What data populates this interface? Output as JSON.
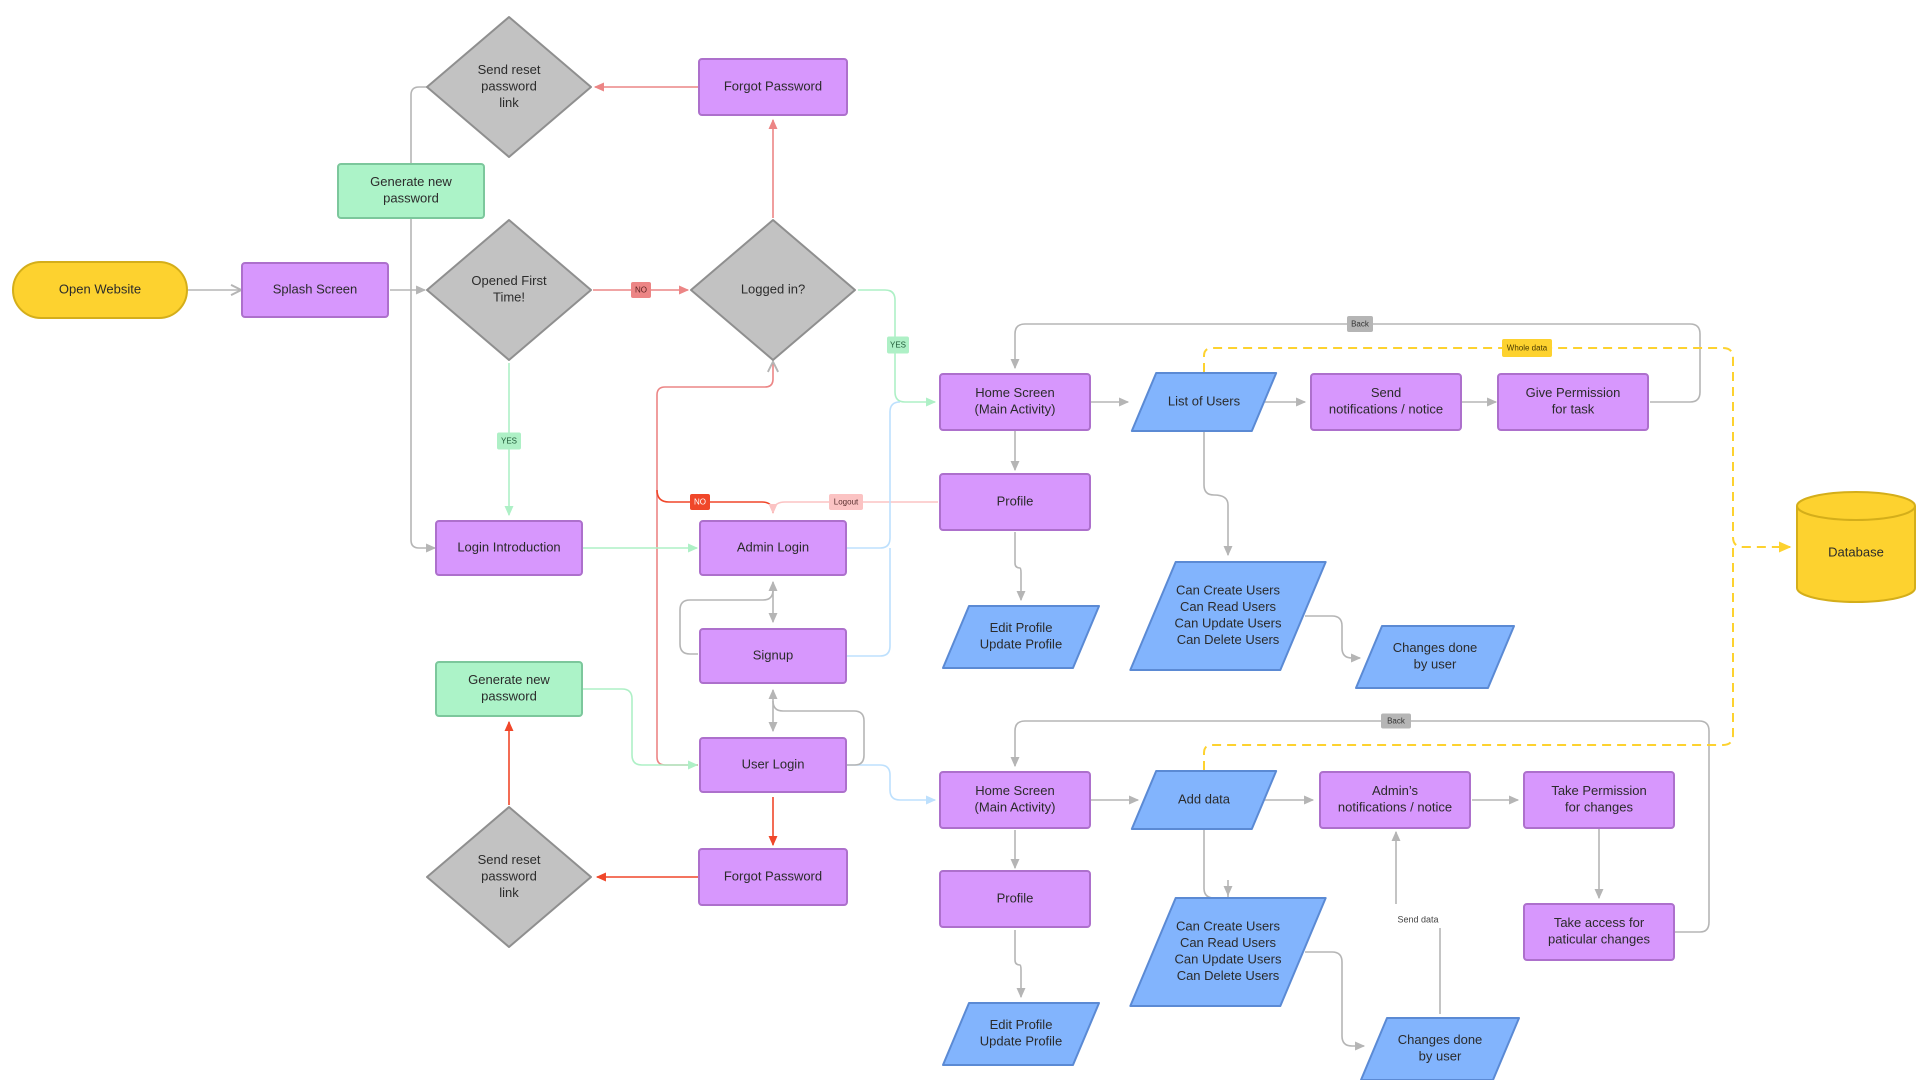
{
  "diagram": {
    "colors": {
      "terminal_fill": "#fdd22f",
      "terminal_stroke": "#d4ae1a",
      "process_fill": "#d797fd",
      "process_stroke": "#ad70cc",
      "decision_fill": "#c2c2c2",
      "decision_stroke": "#8f8f8f",
      "io_fill": "#82b4fd",
      "io_stroke": "#5b8ad4",
      "green_fill": "#acf3c8",
      "green_stroke": "#7cc79c",
      "db_fill": "#fdd22f",
      "db_stroke": "#d4ae1a",
      "edge_gray": "#b5b5b5",
      "edge_red": "#ec8585",
      "edge_strong_red": "#f0472a",
      "edge_pink": "#fbc3c3",
      "edge_green": "#aef0c6",
      "edge_blue": "#bde0fd",
      "edge_yellow": "#fdd22f"
    },
    "nodes": {
      "open_website": {
        "lines": [
          "Open Website"
        ]
      },
      "splash_screen": {
        "lines": [
          "Splash Screen"
        ]
      },
      "opened_first_time": {
        "lines": [
          "Opened First",
          "Time!"
        ]
      },
      "logged_in": {
        "lines": [
          "Logged in?"
        ]
      },
      "forgot_password_top": {
        "lines": [
          "Forgot Password"
        ]
      },
      "send_reset_top": {
        "lines": [
          "Send reset",
          "password",
          "link"
        ]
      },
      "generate_password_top": {
        "lines": [
          "Generate new",
          "password"
        ]
      },
      "login_introduction": {
        "lines": [
          "Login Introduction"
        ]
      },
      "admin_login": {
        "lines": [
          "Admin Login"
        ]
      },
      "signup": {
        "lines": [
          "Signup"
        ]
      },
      "user_login": {
        "lines": [
          "User Login"
        ]
      },
      "generate_password_bottom": {
        "lines": [
          "Generate new",
          "password"
        ]
      },
      "forgot_password_bottom": {
        "lines": [
          "Forgot Password"
        ]
      },
      "send_reset_bottom": {
        "lines": [
          "Send reset",
          "password",
          "link"
        ]
      },
      "admin_home": {
        "lines": [
          "Home Screen",
          "(Main Activity)"
        ]
      },
      "admin_profile": {
        "lines": [
          "Profile"
        ]
      },
      "admin_edit_profile": {
        "lines": [
          "Edit Profile",
          "Update Profile"
        ]
      },
      "list_of_users": {
        "lines": [
          "List of Users"
        ]
      },
      "send_notifications": {
        "lines": [
          "Send",
          "notifications / notice"
        ]
      },
      "give_permission": {
        "lines": [
          "Give Permission",
          "for task"
        ]
      },
      "admin_crud": {
        "lines": [
          "Can Create Users",
          "Can Read Users",
          "Can Update Users",
          "Can Delete Users"
        ]
      },
      "admin_changes": {
        "lines": [
          "Changes done",
          "by user"
        ]
      },
      "database": {
        "lines": [
          "Database"
        ]
      },
      "user_home": {
        "lines": [
          "Home Screen",
          "(Main Activity)"
        ]
      },
      "user_profile": {
        "lines": [
          "Profile"
        ]
      },
      "user_edit_profile": {
        "lines": [
          "Edit Profile",
          "Update Profile"
        ]
      },
      "add_data": {
        "lines": [
          "Add data"
        ]
      },
      "admin_notifications": {
        "lines": [
          "Admin’s",
          "notifications / notice"
        ]
      },
      "take_permission": {
        "lines": [
          "Take Permission",
          "for changes"
        ]
      },
      "take_access": {
        "lines": [
          "Take access for",
          "paticular changes"
        ]
      },
      "user_crud": {
        "lines": [
          "Can Create Users",
          "Can Read Users",
          "Can Update Users",
          "Can Delete Users"
        ]
      },
      "user_changes": {
        "lines": [
          "Changes done",
          "by user"
        ]
      }
    },
    "edge_labels": {
      "no_first": "NO",
      "yes_first": "YES",
      "yes_logged": "YES",
      "no_logged": "NO",
      "logout": "Logout",
      "back_admin": "Back",
      "back_user": "Back",
      "whole_data": "Whole data",
      "send_data": "Send data"
    }
  }
}
